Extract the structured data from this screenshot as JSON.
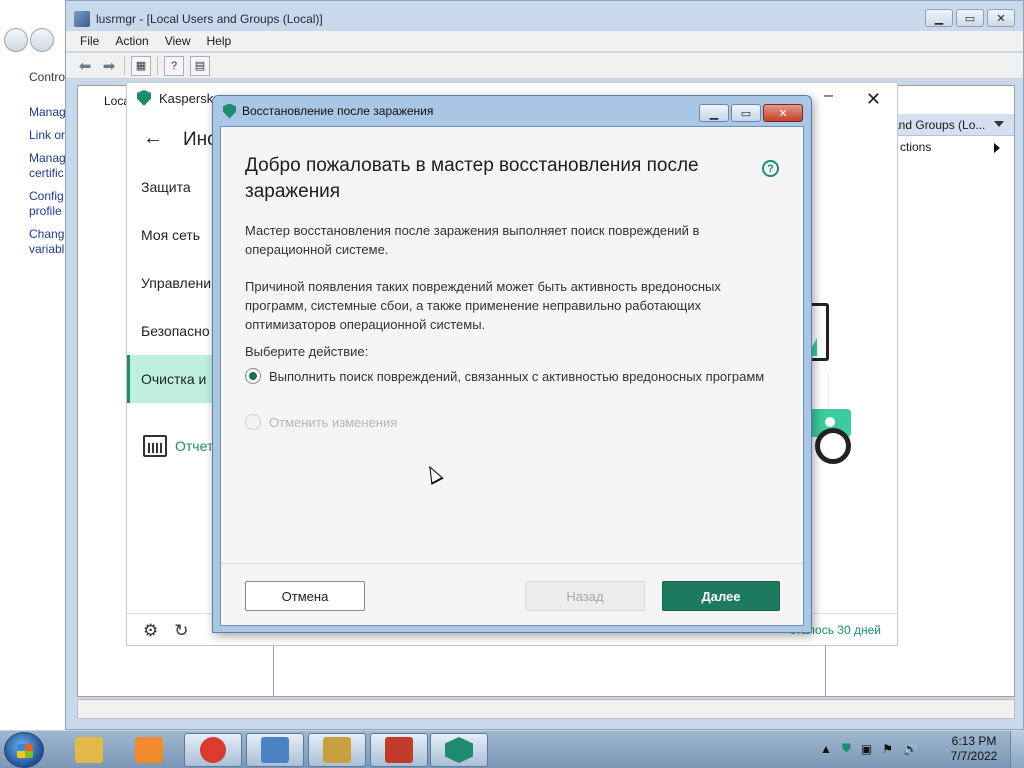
{
  "control_panel": {
    "links": [
      "Control",
      "Manag",
      "Link or",
      "Manag certific",
      "Config profile",
      "Chang variabl"
    ]
  },
  "lusrmgr": {
    "title": "lusrmgr - [Local Users and Groups (Local)]",
    "menu": [
      "File",
      "Action",
      "View",
      "Help"
    ],
    "tree_item": "Local",
    "actions_header": "and Groups (Lo...",
    "actions_item": "ctions"
  },
  "kaspersky": {
    "title": "Kaspersk",
    "header_title": "Ино",
    "nav": [
      "Защита",
      "Моя сеть",
      "Управлени",
      "Безопасно",
      "Очистка и"
    ],
    "active_nav_index": 4,
    "report_label": "Отчет",
    "licence": "сталось 30 дней"
  },
  "wizard": {
    "window_title": "Восстановление после заражения",
    "heading": "Добро пожаловать в мастер восстановления после заражения",
    "help_icon": "?",
    "paragraph1": "Мастер восстановления после заражения выполняет поиск повреждений в операционной системе.",
    "paragraph2": "Причиной появления таких повреждений может быть активность вредоносных программ, системные сбои, а также применение неправильно работающих оптимизаторов операционной системы.",
    "choose_label": "Выберите действие:",
    "option1": "Выполнить поиск повреждений, связанных с активностью вредоносных программ",
    "option1_selected": true,
    "option2": "Отменить изменения",
    "option2_enabled": false,
    "cancel_label": "Отмена",
    "back_label": "Назад",
    "back_enabled": false,
    "next_label": "Далее"
  },
  "taskbar": {
    "apps": [
      {
        "name": "explorer-taskbar-icon",
        "color": "#e3b94b"
      },
      {
        "name": "media-player-taskbar-icon",
        "color": "#f08a2c"
      },
      {
        "name": "chrome-taskbar-icon",
        "color": "#d93b2f"
      },
      {
        "name": "control-panel-taskbar-icon",
        "color": "#4a82c3"
      },
      {
        "name": "users-taskbar-icon",
        "color": "#c9a040"
      },
      {
        "name": "toolbox-taskbar-icon",
        "color": "#c23a2a"
      },
      {
        "name": "kaspersky-taskbar-icon",
        "color": "#1e8c6e"
      }
    ],
    "time": "6:13 PM",
    "date": "7/7/2022"
  },
  "colors": {
    "accent": "#1e8c6e",
    "next_button": "#1e7a5e",
    "active_nav": "#bff0df"
  }
}
